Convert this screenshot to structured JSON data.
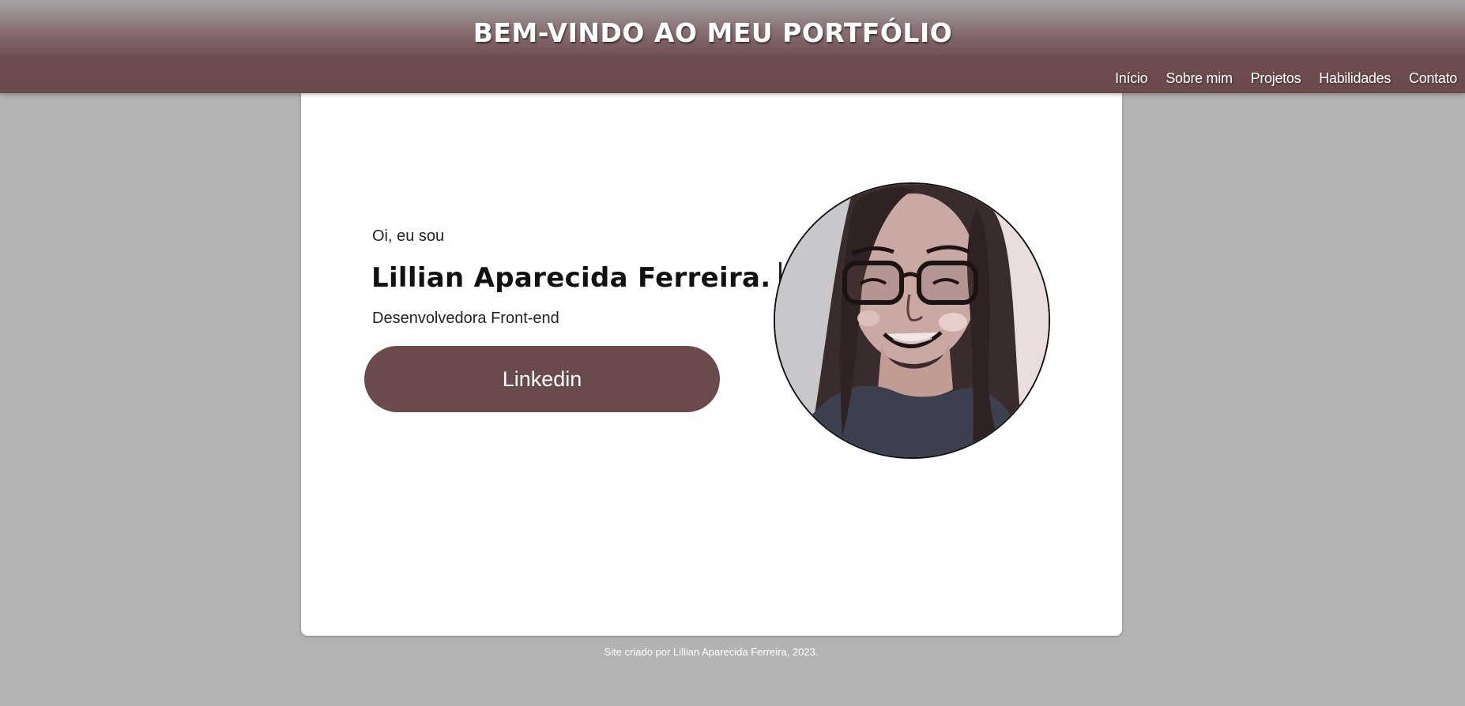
{
  "header": {
    "title": "BEM-VINDO AO MEU PORTFÓLIO",
    "nav": [
      {
        "label": "Início"
      },
      {
        "label": "Sobre mim"
      },
      {
        "label": "Projetos"
      },
      {
        "label": "Habilidades"
      },
      {
        "label": "Contato"
      }
    ]
  },
  "hero": {
    "greeting": "Oi, eu sou",
    "name": "Lillian Aparecida Ferreira.",
    "role": "Desenvolvedora Front-end",
    "button_label": "Linkedin",
    "avatar_icon": "profile-photo"
  },
  "footer": {
    "text": "Site criado por Lillian Aparecida Ferreira, 2023."
  },
  "colors": {
    "accent": "#6b4a4c",
    "background": "#b3b3b3",
    "card": "#ffffff"
  }
}
